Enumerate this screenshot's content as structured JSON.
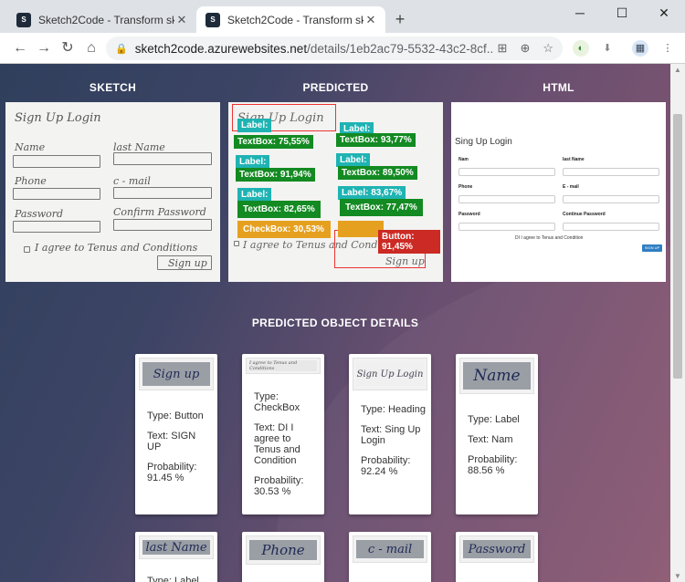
{
  "browser": {
    "tabs": [
      {
        "title": "Sketch2Code - Transform sketc",
        "active": false
      },
      {
        "title": "Sketch2Code - Transform sketc",
        "active": true
      }
    ],
    "new_tab_label": "+",
    "url_host": "sketch2code.azurewebsites.net",
    "url_path": "/details/1eb2ac79-5532-43c2-8cf...",
    "window": {
      "minimize": "─",
      "maximize": "☐",
      "close": "✕"
    }
  },
  "columns": {
    "sketch": "SKETCH",
    "predicted": "PREDICTED",
    "html": "HTML"
  },
  "sketch": {
    "heading": "Sign Up Login",
    "fields": [
      "Name",
      "last Name",
      "Phone",
      "c - mail",
      "Password",
      "Confirm Password"
    ],
    "checkbox": "I agree to Tenus and Conditions",
    "button": "Sign up"
  },
  "predicted": {
    "detections": [
      {
        "label": "Label:",
        "color": "teal"
      },
      {
        "label": "Label:",
        "color": "teal"
      },
      {
        "label": "TextBox: 75,55%",
        "color": "green"
      },
      {
        "label": "TextBox: 93,77%",
        "color": "green"
      },
      {
        "label": "Label:",
        "color": "teal"
      },
      {
        "label": "Label:",
        "color": "teal"
      },
      {
        "label": "TextBox: 91,94%",
        "color": "green"
      },
      {
        "label": "TextBox: 89,50%",
        "color": "green"
      },
      {
        "label": "Label:",
        "color": "teal"
      },
      {
        "label": "Label: 83,67%",
        "color": "teal"
      },
      {
        "label": "TextBox: 82,65%",
        "color": "green"
      },
      {
        "label": "TextBox: 77,47%",
        "color": "green"
      },
      {
        "label": "CheckBox: 30,53%",
        "color": "orange"
      },
      {
        "label": "Button: 91,45%",
        "color": "red"
      }
    ]
  },
  "html_preview": {
    "title": "Sing Up Login",
    "labels": [
      "Nam",
      "last Name",
      "Phone",
      "E - mail",
      "Password",
      "Continue Password"
    ],
    "checkbox": "DI I agree to Tenus and Condition",
    "button": "SIGN UP"
  },
  "details": {
    "title": "PREDICTED OBJECT DETAILS",
    "cards": [
      {
        "image_text": "Sign up",
        "type": "Type: Button",
        "text": "Text: SIGN UP",
        "probability": "Probability: 91.45 %"
      },
      {
        "image_text": "I agree to Tenus and Conditions",
        "type": "Type: CheckBox",
        "text": "Text: DI I agree to Tenus and Condition",
        "probability": "Probability: 30.53 %"
      },
      {
        "image_text": "Sign Up Login",
        "type": "Type: Heading",
        "text": "Text: Sing Up Login",
        "probability": "Probability: 92.24 %"
      },
      {
        "image_text": "Name",
        "type": "Type: Label",
        "text": "Text: Nam",
        "probability": "Probability: 88.56 %"
      },
      {
        "image_text": "last Name",
        "type": "Type: Label",
        "text": "",
        "probability": ""
      },
      {
        "image_text": "Phone",
        "type": "",
        "text": "",
        "probability": ""
      },
      {
        "image_text": "c - mail",
        "type": "",
        "text": "",
        "probability": ""
      },
      {
        "image_text": "Password",
        "type": "",
        "text": "",
        "probability": ""
      }
    ]
  },
  "colors": {
    "green": "#138a22",
    "teal": "#1fb3b3",
    "orange": "#e6a020",
    "red": "#cc2a24",
    "button_blue": "#2f7ec3"
  }
}
